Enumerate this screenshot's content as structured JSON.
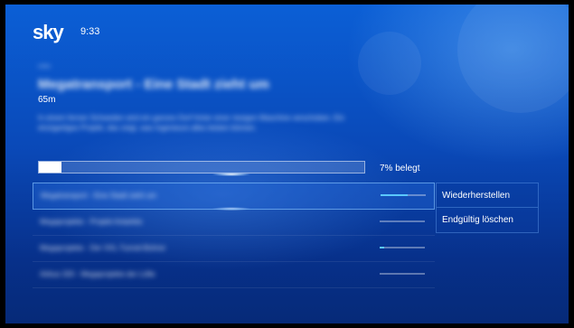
{
  "header": {
    "logo": "sky",
    "time": "9:33"
  },
  "detail": {
    "category": "Doku",
    "title": "Megatransport - Eine Stadt zieht um",
    "duration": "65m",
    "description": "In einem fernen Schweden wird ein ganzes Dorf hinter einer riesigen Maschine verschoben. Ein einzigartiges Projekt, das zeigt, was Ingenieure alles leisten können."
  },
  "storage": {
    "used_percent": 7,
    "label": "7% belegt"
  },
  "recordings": [
    {
      "title": "Megatransport - Eine Stadt zieht um",
      "progress": 0.6
    },
    {
      "title": "Megaprojekte - Projekt Antarktis",
      "progress": 0.0
    },
    {
      "title": "Megaprojekte - Der XXL-Tunnel-Bohrer",
      "progress": 0.1
    },
    {
      "title": "Airbus 320 - Megaprojekte der Lüfte",
      "progress": 0.0
    }
  ],
  "context_menu": {
    "items": [
      {
        "label": "Wiederherstellen"
      },
      {
        "label": "Endgültig löschen"
      }
    ]
  },
  "colors": {
    "background": "#0a49b8",
    "progress_fill": "#5ac8ff"
  }
}
